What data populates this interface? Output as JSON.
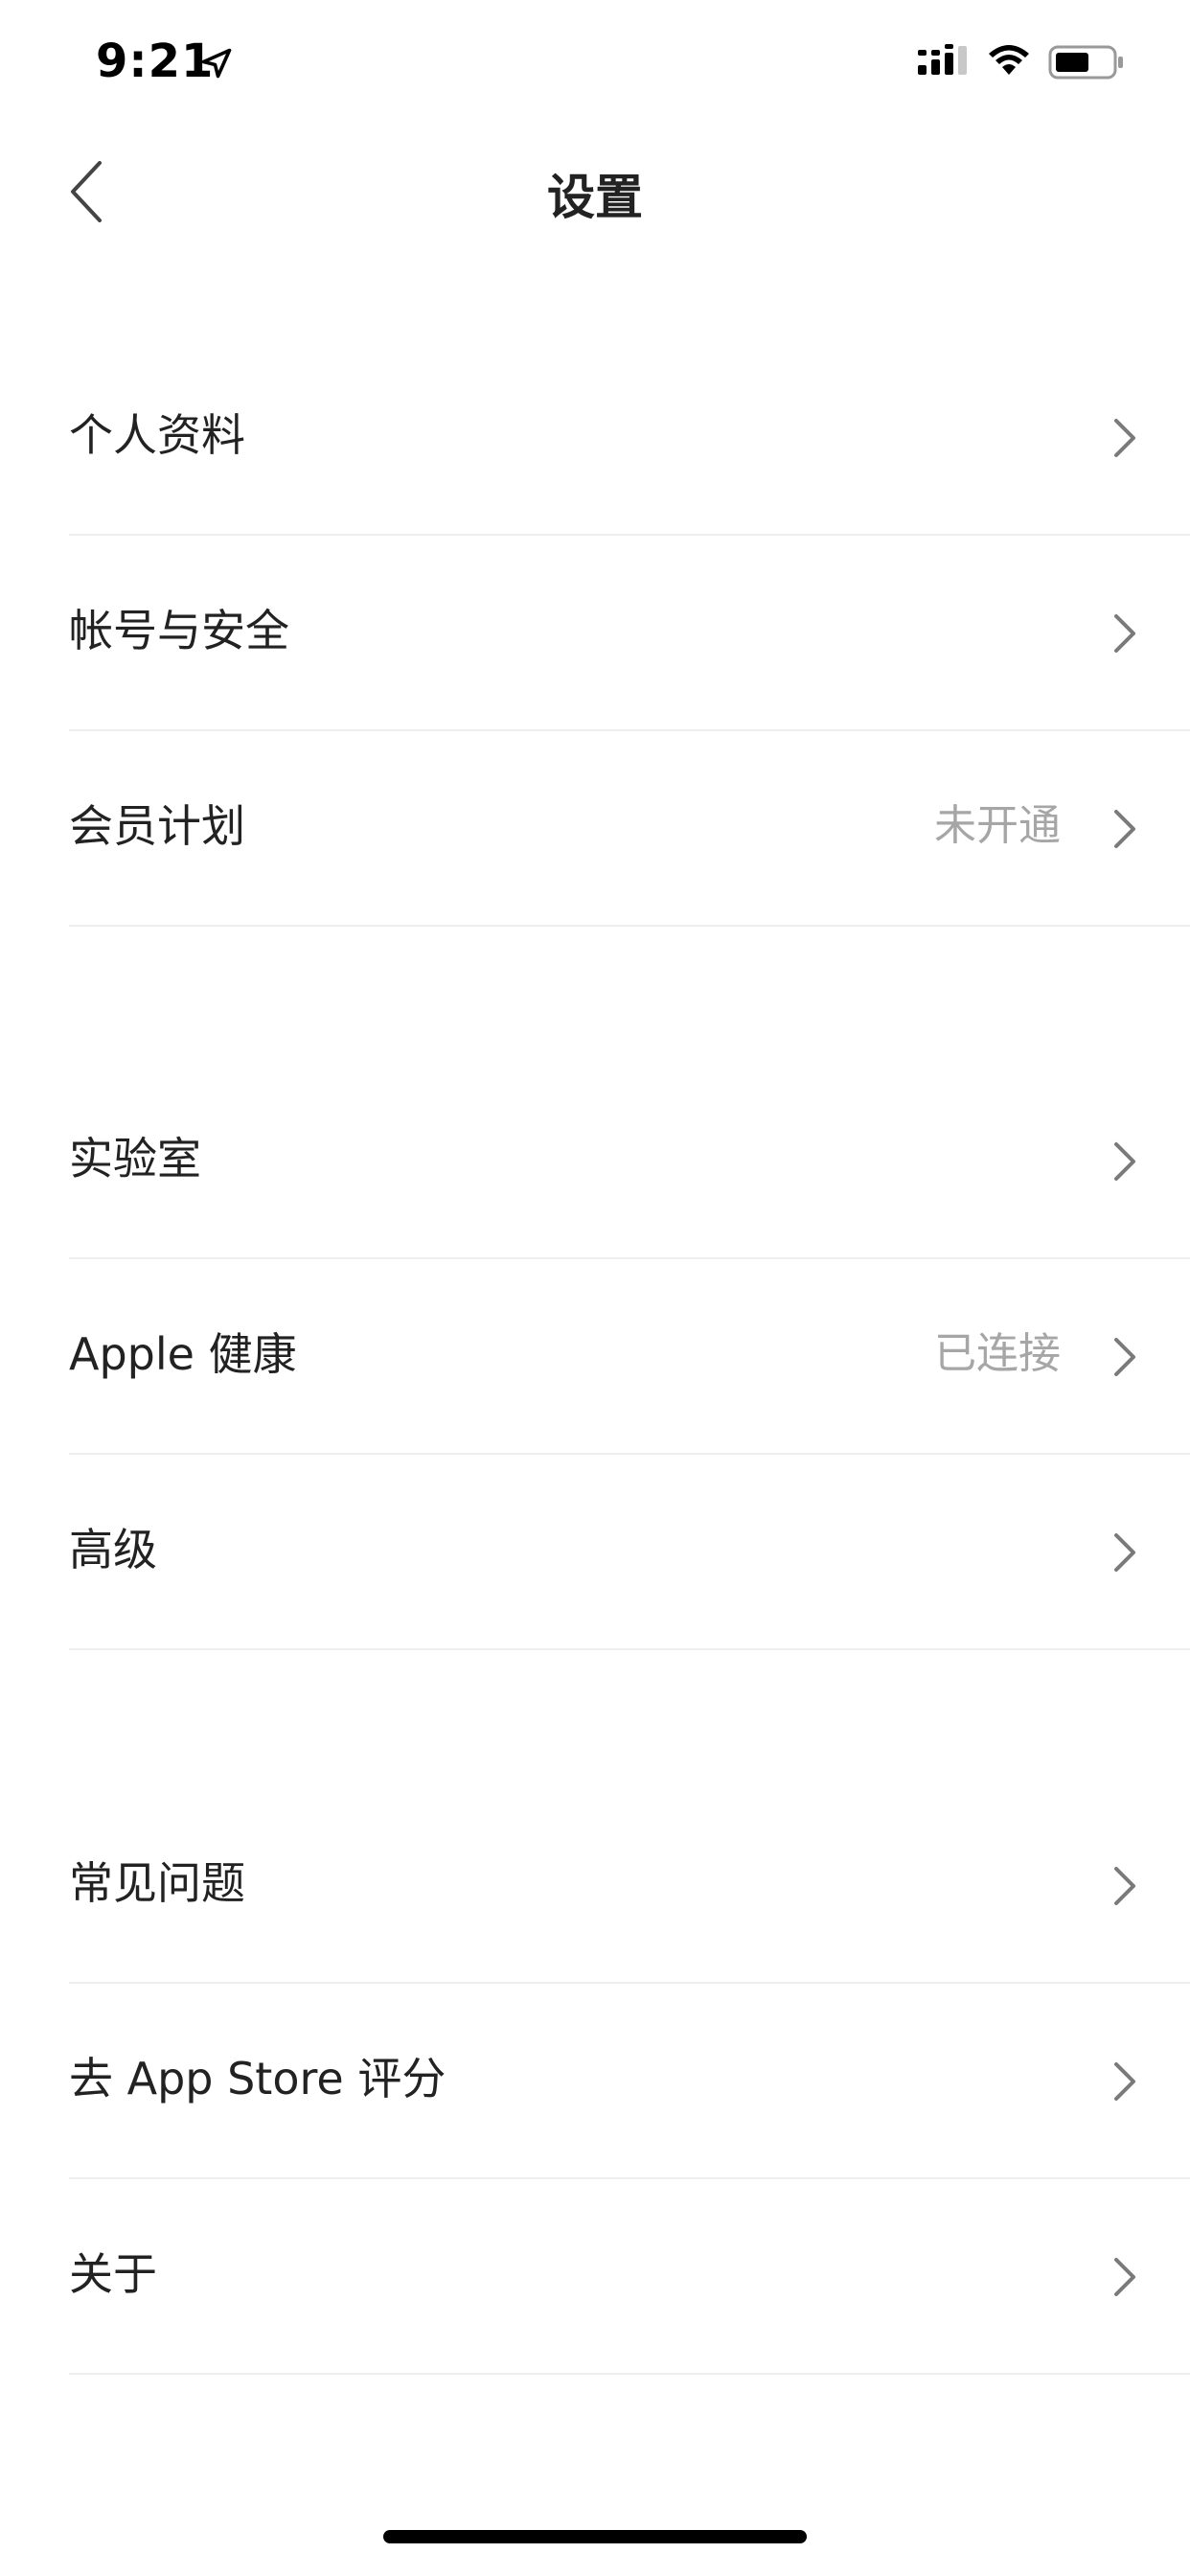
{
  "status_bar": {
    "time": "9:21",
    "icons": [
      "location-arrow-icon",
      "cellular-signal-icon",
      "wifi-icon",
      "battery-icon"
    ]
  },
  "nav": {
    "title": "设置",
    "back_icon": "chevron-left-icon"
  },
  "groups": [
    {
      "items": [
        {
          "label": "个人资料",
          "value": ""
        },
        {
          "label": "帐号与安全",
          "value": ""
        },
        {
          "label": "会员计划",
          "value": "未开通"
        }
      ]
    },
    {
      "items": [
        {
          "label": "实验室",
          "value": ""
        },
        {
          "label": "Apple 健康",
          "value": "已连接"
        },
        {
          "label": "高级",
          "value": ""
        }
      ]
    },
    {
      "items": [
        {
          "label": "常见问题",
          "value": ""
        },
        {
          "label": "去 App Store 评分",
          "value": ""
        },
        {
          "label": "关于",
          "value": ""
        }
      ]
    }
  ],
  "colors": {
    "text_primary": "#222222",
    "text_secondary": "#a6a6a6",
    "divider": "#eeeeee",
    "chevron": "#7a7a7a",
    "background": "#ffffff"
  }
}
